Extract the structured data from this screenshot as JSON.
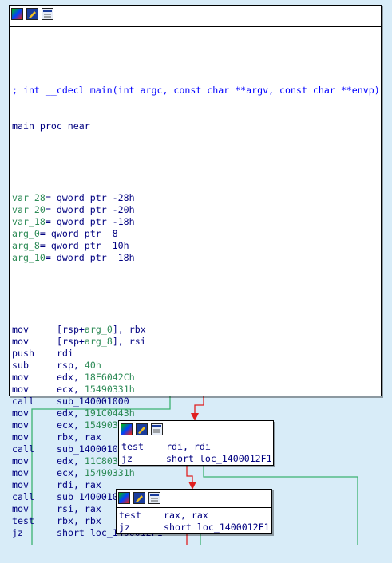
{
  "main_block": {
    "comment": "; int __cdecl main(int argc, const char **argv, const char **envp)",
    "proc_line": "main proc near",
    "vars": [
      {
        "name": "var_28",
        "text": "= qword ptr -28h"
      },
      {
        "name": "var_20",
        "text": "= dword ptr -20h"
      },
      {
        "name": "var_18",
        "text": "= qword ptr -18h"
      },
      {
        "name": "arg_0",
        "text": "= qword ptr  8"
      },
      {
        "name": "arg_8",
        "text": "= qword ptr  10h"
      },
      {
        "name": "arg_10",
        "text": "= dword ptr  18h"
      }
    ],
    "instructions": [
      {
        "mn": "mov",
        "ops": "[rsp+arg_0], rbx"
      },
      {
        "mn": "mov",
        "ops": "[rsp+arg_8], rsi"
      },
      {
        "mn": "push",
        "ops": "rdi"
      },
      {
        "mn": "sub",
        "ops": "rsp, 40h"
      },
      {
        "mn": "mov",
        "ops": "edx, 18E6042Ch"
      },
      {
        "mn": "mov",
        "ops": "ecx, 15490331h"
      },
      {
        "mn": "call",
        "ops": "sub_140001000"
      },
      {
        "mn": "mov",
        "ops": "edx, 191C0443h"
      },
      {
        "mn": "mov",
        "ops": "ecx, 15490331h"
      },
      {
        "mn": "mov",
        "ops": "rbx, rax"
      },
      {
        "mn": "call",
        "ops": "sub_140001000"
      },
      {
        "mn": "mov",
        "ops": "edx, 11C8038Ch"
      },
      {
        "mn": "mov",
        "ops": "ecx, 15490331h"
      },
      {
        "mn": "mov",
        "ops": "rdi, rax"
      },
      {
        "mn": "call",
        "ops": "sub_140001000"
      },
      {
        "mn": "mov",
        "ops": "rsi, rax"
      },
      {
        "mn": "test",
        "ops": "rbx, rbx"
      },
      {
        "mn": "jz",
        "ops": "short loc_1400012F1"
      }
    ]
  },
  "block2": [
    {
      "mn": "test",
      "ops": "rdi, rdi"
    },
    {
      "mn": "jz",
      "ops": "short loc_1400012F1"
    }
  ],
  "block3": [
    {
      "mn": "test",
      "ops": "rax, rax"
    },
    {
      "mn": "jz",
      "ops": "short loc_1400012F1"
    }
  ],
  "icons": [
    "color-palette-icon",
    "edit-node-icon",
    "graph-overview-icon"
  ],
  "colors": {
    "background": "#d8ecf8",
    "instruction": "#000080",
    "comment": "#0000ff",
    "variable": "#2e8b57",
    "edge_true": "#e02020",
    "edge_false": "#3cb371"
  }
}
